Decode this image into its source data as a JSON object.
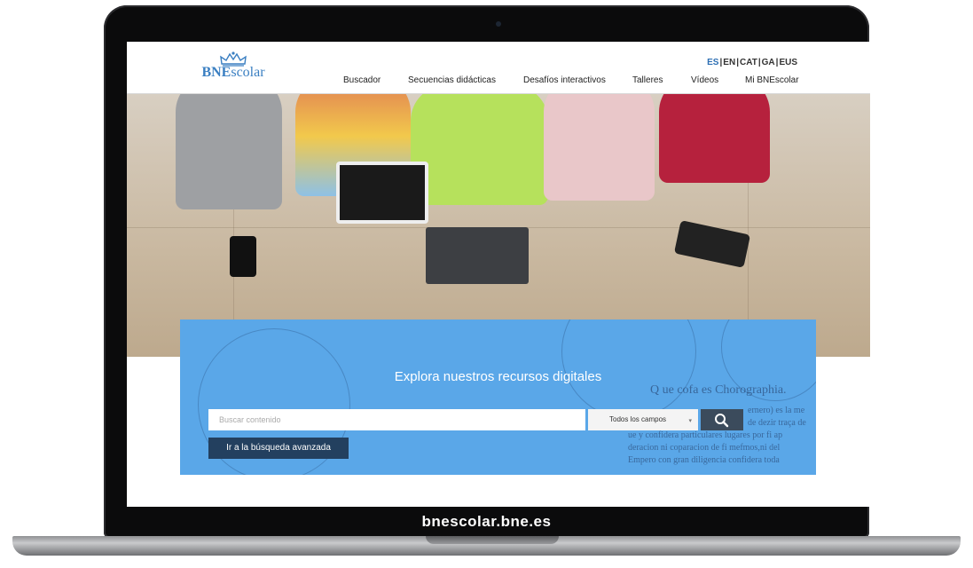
{
  "site": {
    "logo_text_bold": "BNE",
    "logo_text_rest": "scolar",
    "logo_icon": "crown-icon"
  },
  "languages": [
    "ES",
    "EN",
    "CAT",
    "GA",
    "EUS"
  ],
  "active_language": "ES",
  "nav": {
    "items": [
      {
        "label": "Buscador"
      },
      {
        "label": "Secuencias didácticas"
      },
      {
        "label": "Desafíos interactivos"
      },
      {
        "label": "Talleres"
      },
      {
        "label": "Vídeos"
      },
      {
        "label": "Mi BNEscolar"
      }
    ]
  },
  "search": {
    "title": "Explora nuestros recursos digitales",
    "placeholder": "Buscar contenido",
    "field_selected": "Todos los campos",
    "search_icon": "search-icon",
    "advanced_label": "Ir a la búsqueda avanzada"
  },
  "decor_text": {
    "line1": "Q ue cofa es Chorographia.",
    "line2": "ernero) es la me",
    "line3": "de dezir traça de",
    "line4": "ue y confidera particulares lugares por fi ap",
    "line5": "deracion ni coparacion de fi mefmos,ni del",
    "line6": "Empero con gran diligencia confidera toda"
  },
  "footer_domain": "bnescolar.bne.es",
  "colors": {
    "accent": "#2d6fb4",
    "panel": "#5aa7e8",
    "advanced_button": "#23405f"
  }
}
